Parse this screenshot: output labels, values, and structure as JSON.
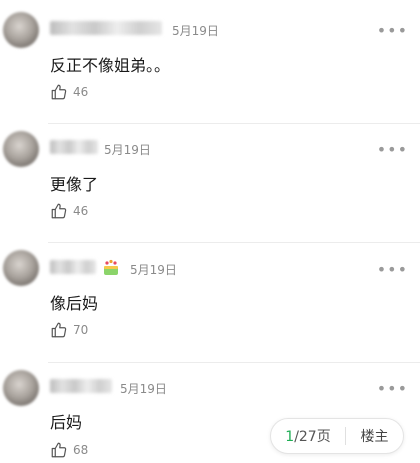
{
  "comments": [
    {
      "date": "5月19日",
      "text": "反正不像姐弟。。",
      "likes": "46"
    },
    {
      "date": "5月19日",
      "text": "更像了",
      "likes": "46"
    },
    {
      "date": "5月19日",
      "text": "像后妈",
      "likes": "70"
    },
    {
      "date": "5月19日",
      "text": "后妈",
      "likes": "68"
    }
  ],
  "pager": {
    "current": "1",
    "total": "/27页",
    "op_label": "楼主"
  },
  "colors": {
    "accent": "#1fae55",
    "meta": "#8a8a8a",
    "divider": "#ececec"
  },
  "icons": {
    "like": "thumbs-up-icon",
    "more": "more-dots-icon",
    "badge": "cake-badge-icon"
  }
}
